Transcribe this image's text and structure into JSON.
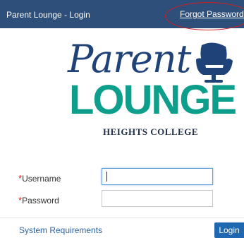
{
  "header": {
    "title": "Parent Lounge - Login",
    "forgot_link": "Forgot Password?"
  },
  "logo": {
    "script_text": "Parent",
    "word_text": "LOUNGE",
    "subtitle": "HEIGHTS COLLEGE"
  },
  "form": {
    "required_marker": "*",
    "username_label": "Username",
    "password_label": "Password",
    "username_value": "",
    "password_value": ""
  },
  "footer": {
    "system_requirements": "System Requirements",
    "login_button": "Login"
  },
  "colors": {
    "header_bg": "#2f4f7b",
    "accent_teal": "#0e9e8c",
    "accent_navy": "#1f4279",
    "highlight_ring": "#d21f25",
    "button_bg": "#1f67b1"
  }
}
